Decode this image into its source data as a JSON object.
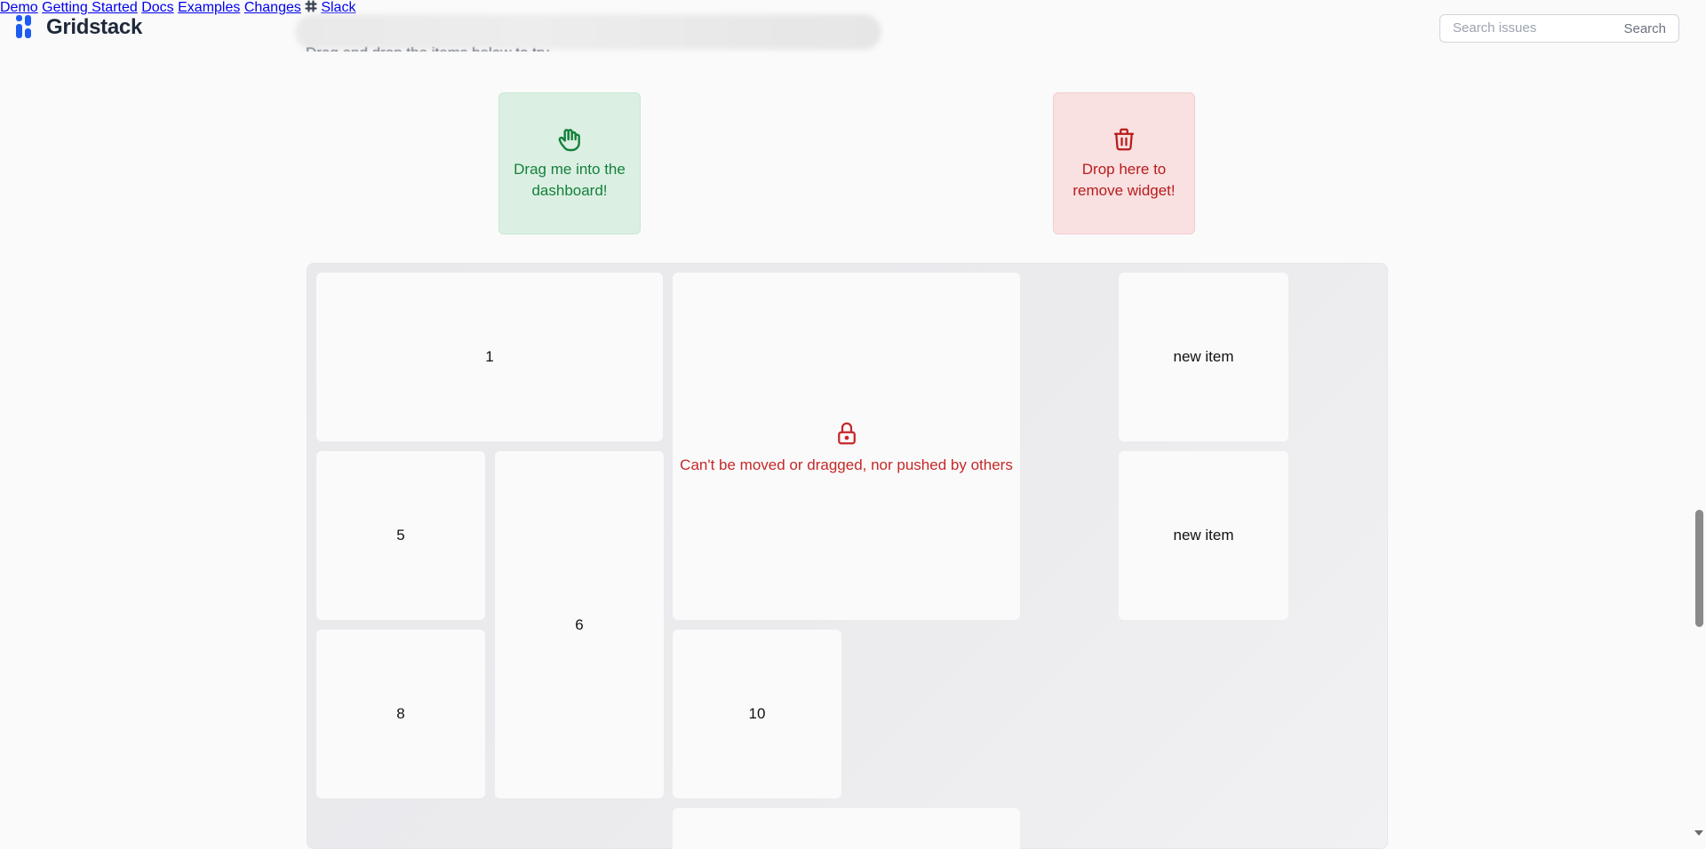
{
  "brand": {
    "name": "Gridstack",
    "accent": "#1d5cf0"
  },
  "page": {
    "subtitle": "Drag and drop the items below to try."
  },
  "nav": [
    {
      "label": "Demo"
    },
    {
      "label": "Getting Started"
    },
    {
      "label": "Docs"
    },
    {
      "label": "Examples"
    },
    {
      "label": "Changes"
    },
    {
      "label": "Slack",
      "icon": "slack-icon"
    }
  ],
  "search": {
    "placeholder": "Search issues",
    "button_label": "Search"
  },
  "drag_card": {
    "icon": "hand-icon",
    "text": "Drag me into the dashboard!",
    "color": "#15803d"
  },
  "trash_card": {
    "icon": "trash-icon",
    "text": "Drop here to remove widget!",
    "color": "#b91c1c"
  },
  "grid": {
    "items": [
      {
        "label": "1"
      },
      {
        "label": "Can't be moved or dragged, nor pushed by others",
        "icon": "lock-icon",
        "locked": true
      },
      {
        "label": "new item"
      },
      {
        "label": "5"
      },
      {
        "label": "6"
      },
      {
        "label": "new item"
      },
      {
        "label": "8"
      },
      {
        "label": "10"
      }
    ]
  }
}
